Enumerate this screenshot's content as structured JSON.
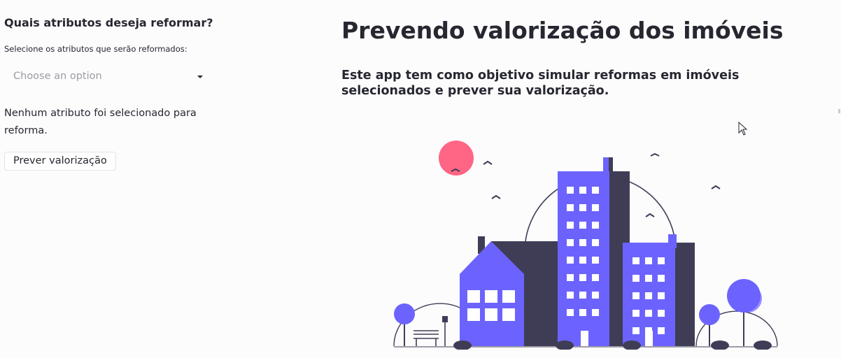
{
  "sidebar": {
    "heading": "Quais atributos deseja reformar?",
    "select_label": "Selecione os atributos que serão reformados:",
    "select_placeholder": "Choose an option",
    "info_text": "Nenhum atributo foi selecionado para reforma.",
    "button_label": "Prever valorização"
  },
  "main": {
    "title": "Prevendo valorização dos imóveis",
    "subtitle": "Este app tem como objetivo simular reformas em imóveis selecionados e prever sua valorização."
  },
  "colors": {
    "building": "#6c63ff",
    "dark": "#3f3d56",
    "sun": "#ff6584",
    "window": "#ffffff"
  },
  "icons": {
    "select_caret": "chevron-down-icon",
    "mouse_cursor": "cursor-icon"
  }
}
